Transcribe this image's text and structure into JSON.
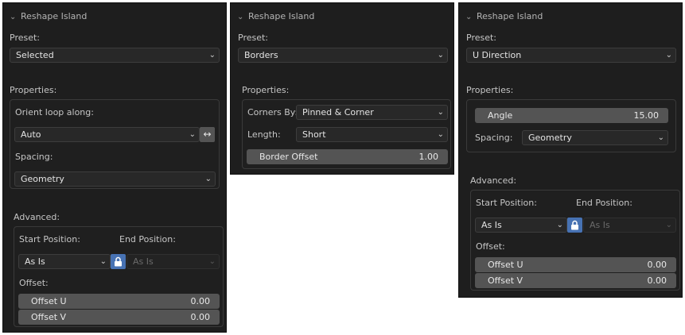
{
  "panels": [
    {
      "title": "Reshape Island",
      "preset_label": "Preset:",
      "preset_value": "Selected",
      "properties_label": "Properties:",
      "orient_label": "Orient loop along:",
      "orient_value": "Auto",
      "swap_icon": "↔",
      "spacing_label": "Spacing:",
      "spacing_value": "Geometry",
      "advanced_label": "Advanced:",
      "start_label": "Start Position:",
      "end_label": "End Position:",
      "start_value": "As Is",
      "end_value": "As Is",
      "offset_label": "Offset:",
      "offset_u_label": "Offset U",
      "offset_u_value": "0.00",
      "offset_v_label": "Offset V",
      "offset_v_value": "0.00"
    },
    {
      "title": "Reshape Island",
      "preset_label": "Preset:",
      "preset_value": "Borders",
      "properties_label": "Properties:",
      "corners_label": "Corners By:",
      "corners_value": "Pinned & Corner",
      "length_label": "Length:",
      "length_value": "Short",
      "border_offset_label": "Border Offset",
      "border_offset_value": "1.00"
    },
    {
      "title": "Reshape Island",
      "preset_label": "Preset:",
      "preset_value": "U Direction",
      "properties_label": "Properties:",
      "angle_label": "Angle",
      "angle_value": "15.00",
      "spacing_label": "Spacing:",
      "spacing_value": "Geometry",
      "advanced_label": "Advanced:",
      "start_label": "Start Position:",
      "end_label": "End Position:",
      "start_value": "As Is",
      "end_value": "As Is",
      "offset_label": "Offset:",
      "offset_u_label": "Offset U",
      "offset_u_value": "0.00",
      "offset_v_label": "Offset V",
      "offset_v_value": "0.00"
    }
  ],
  "icons": {
    "collapse": "chevron-down-icon",
    "dropdown": "chevron-down-icon",
    "lock": "lock-icon",
    "swap": "swap-arrows-icon"
  },
  "colors": {
    "panel_bg": "#1e1e1e",
    "dropdown_bg": "#282828",
    "field_bg": "#545454",
    "lock_accent": "#4772b3"
  }
}
